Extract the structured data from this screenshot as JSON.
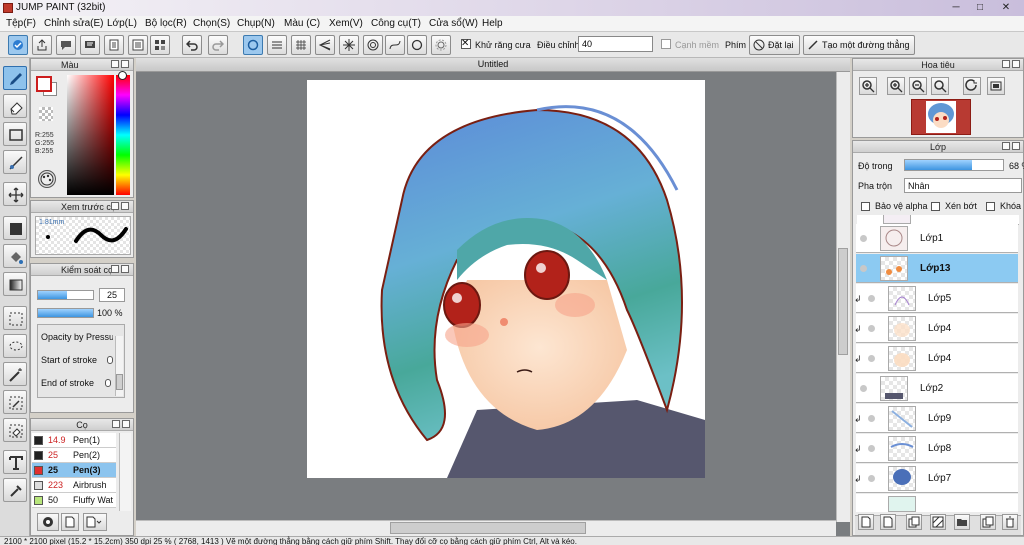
{
  "window": {
    "title": "JUMP PAINT (32bit)",
    "controls": [
      "─",
      "□",
      "✕"
    ]
  },
  "menu": [
    "Tệp(F)",
    "Chỉnh sửa(E)",
    "Lớp(L)",
    "Bộ lọc(R)",
    "Chọn(S)",
    "Chụp(N)",
    "Màu (C)",
    "Xem(V)",
    "Công cụ(T)",
    "Cửa sổ(W)",
    "Help"
  ],
  "toolbar": {
    "antialias_label": "Khử răng cưa",
    "correction_label": "Điều chỉnh",
    "correction_value": "40",
    "fine_label": "Cạnh mềm",
    "key_label": "Phím",
    "reset_label": "Đặt lại",
    "straight_line_label": "Tạo một đường thẳng"
  },
  "color_panel": {
    "title": "Màu",
    "r": "R:255",
    "g": "G:255",
    "b": "B:255",
    "primary": "#ffffff",
    "secondary": "#ffffff"
  },
  "brush_preview": {
    "title": "Xem trước cọ",
    "size": "1.81mm"
  },
  "brush_control": {
    "title": "Kiểm soát cọ",
    "size": "25",
    "opacity": "100 %",
    "opacity_pressure": "Opacity by Pressu",
    "start_stroke": "Start of stroke",
    "end_stroke": "End of stroke"
  },
  "brush_list": {
    "title": "Cọ",
    "items": [
      {
        "size": "14.9",
        "name": "Pen(1)",
        "color": "#222222",
        "size_color": "#cc2222"
      },
      {
        "size": "25",
        "name": "Pen(2)",
        "color": "#222222",
        "size_color": "#cc2222"
      },
      {
        "size": "25",
        "name": "Pen(3)",
        "color": "#e03030",
        "size_color": "#111111",
        "selected": true
      },
      {
        "size": "223",
        "name": "Airbrush",
        "color": "#dddddd",
        "size_color": "#cc2222"
      },
      {
        "size": "50",
        "name": "Fluffy Wat",
        "color": "#b8e67c",
        "size_color": "#111111"
      }
    ]
  },
  "document": {
    "tab": "Untitled"
  },
  "navigator": {
    "title": "Hoa tiêu"
  },
  "layers": {
    "title": "Lớp",
    "opacity_label": "Độ trong",
    "opacity_value": "68 %",
    "opacity": 0.68,
    "blend_label": "Pha trộn",
    "blend_value": "Nhân",
    "protect_alpha": "Bảo vệ alpha",
    "clipping": "Xén bớt",
    "lock": "Khóa",
    "items": [
      {
        "name": "Lớp1"
      },
      {
        "name": "Lớp13",
        "selected": true
      },
      {
        "name": "Lớp5",
        "clipped": true
      },
      {
        "name": "Lớp4",
        "clipped": true
      },
      {
        "name": "Lớp4",
        "clipped": true
      },
      {
        "name": "Lớp2"
      },
      {
        "name": "Lớp9",
        "clipped": true
      },
      {
        "name": "Lớp8",
        "clipped": true
      },
      {
        "name": "Lớp7",
        "clipped": true
      }
    ]
  },
  "status": {
    "text": "2100 * 2100 pixel  (15.2 * 15.2cm)  350 dpi  25 %  ( 2768, 1413 )  Vẽ một đường thẳng bằng cách giữ phím Shift. Thay đổi cỡ cọ bằng cách giữ phím Ctrl, Alt và kéo."
  }
}
